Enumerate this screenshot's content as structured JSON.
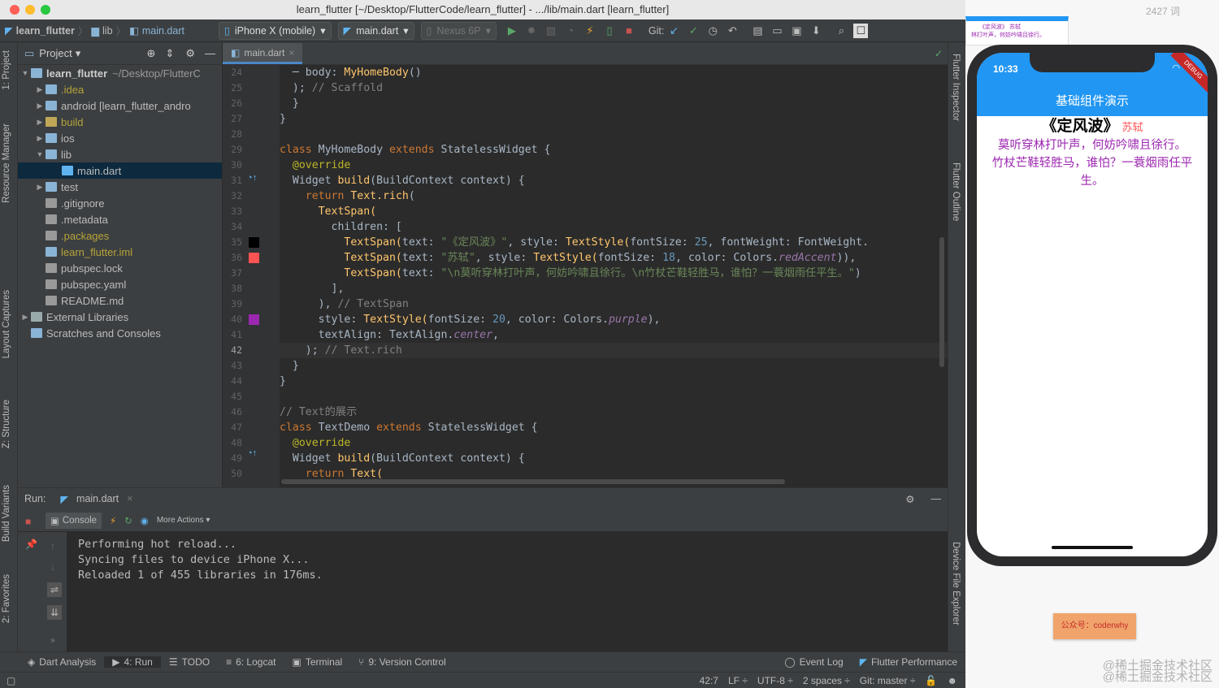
{
  "window": {
    "title": "learn_flutter [~/Desktop/FlutterCode/learn_flutter] - .../lib/main.dart [learn_flutter]"
  },
  "navbar": {
    "crumbs": [
      "learn_flutter",
      "lib",
      "main.dart"
    ],
    "device": "iPhone X (mobile)",
    "run_config": "main.dart",
    "emulator": "Nexus 6P",
    "git_label": "Git:"
  },
  "left_tabs": [
    "1: Project",
    "Resource Manager",
    "Layout Captures",
    "Z: Structure",
    "Build Variants",
    "2: Favorites"
  ],
  "right_tabs": [
    "Flutter Inspector",
    "Flutter Outline",
    "Device File Explorer"
  ],
  "project": {
    "header": "Project",
    "root_name": "learn_flutter",
    "root_path": "~/Desktop/FlutterC",
    "items": [
      {
        "name": ".idea",
        "color": "#b5a33a"
      },
      {
        "name": "android [learn_flutter_andro",
        "color": "#bbbbbb"
      },
      {
        "name": "build",
        "color": "#b5a33a"
      },
      {
        "name": "ios",
        "color": "#bbbbbb"
      },
      {
        "name": "lib",
        "color": "#bbbbbb"
      },
      {
        "name": "main.dart",
        "color": "#bbbbbb"
      },
      {
        "name": "test",
        "color": "#bbbbbb"
      },
      {
        "name": ".gitignore",
        "color": "#bbbbbb"
      },
      {
        "name": ".metadata",
        "color": "#bbbbbb"
      },
      {
        "name": ".packages",
        "color": "#b5a33a"
      },
      {
        "name": "learn_flutter.iml",
        "color": "#b5a33a"
      },
      {
        "name": "pubspec.lock",
        "color": "#bbbbbb"
      },
      {
        "name": "pubspec.yaml",
        "color": "#bbbbbb"
      },
      {
        "name": "README.md",
        "color": "#bbbbbb"
      },
      {
        "name": "External Libraries",
        "color": "#bbbbbb"
      },
      {
        "name": "Scratches and Consoles",
        "color": "#bbbbbb"
      }
    ]
  },
  "editor": {
    "tab": "main.dart",
    "line_numbers": [
      "24",
      "25",
      "26",
      "27",
      "28",
      "29",
      "30",
      "31",
      "32",
      "33",
      "34",
      "35",
      "36",
      "37",
      "38",
      "39",
      "40",
      "41",
      "42",
      "43",
      "44",
      "45",
      "46",
      "47",
      "48",
      "49",
      "50"
    ],
    "code": {
      "l24_a": "body: ",
      "l24_b": "MyHomeBody",
      "l24_c": "()",
      "l25_a": "); ",
      "l25_b": "// Scaffold",
      "l26": "}",
      "l27": "}",
      "l29_a": "class ",
      "l29_b": "MyHomeBody ",
      "l29_c": "extends ",
      "l29_d": "StatelessWidget {",
      "l30": "@override",
      "l31_a": "Widget ",
      "l31_b": "build",
      "l31_c": "(BuildContext context) {",
      "l32_a": "return ",
      "l32_b": "Text.rich",
      "l33": "TextSpan(",
      "l34": "children: [",
      "l35_a": "TextSpan(",
      "l35_b": "text: ",
      "l35_c": "\"《定风波》\"",
      "l35_d": ", style: ",
      "l35_e": "TextStyle(",
      "l35_f": "fontSize: ",
      "l35_g": "25",
      "l35_h": ", fontWeight: FontWeight.",
      "l36_a": "TextSpan(",
      "l36_b": "text: ",
      "l36_c": "\"苏轼\"",
      "l36_d": ", style: ",
      "l36_e": "TextStyle(",
      "l36_f": "fontSize: ",
      "l36_g": "18",
      "l36_h": ", color: Colors.",
      "l36_i": "redAccent",
      "l36_j": ")),",
      "l37_a": "TextSpan(",
      "l37_b": "text: ",
      "l37_c": "\"\\n莫听穿林打叶声，何妨吟啸且徐行。\\n竹杖芒鞋轻胜马，谁怕？一蓑烟雨任平生。\"",
      "l37_d": ")",
      "l38": "],",
      "l39_a": "), ",
      "l39_b": "// TextSpan",
      "l40_a": "style: ",
      "l40_b": "TextStyle(",
      "l40_c": "fontSize: ",
      "l40_d": "20",
      "l40_e": ", color: Colors.",
      "l40_f": "purple",
      "l40_g": "),",
      "l41_a": "textAlign: TextAlign.",
      "l41_b": "center",
      "l41_c": ",",
      "l42_a": "); ",
      "l42_b": "// Text.rich",
      "l43": "}",
      "l44": "}",
      "l46": "// Text的展示",
      "l47_a": "class ",
      "l47_b": "TextDemo ",
      "l47_c": "extends ",
      "l47_d": "StatelessWidget {",
      "l48": "@override",
      "l49_a": "Widget ",
      "l49_b": "build",
      "l49_c": "(BuildContext context) {",
      "l50_a": "return ",
      "l50_b": "Text("
    },
    "swatch_colors": {
      "black": "#000000",
      "red_accent": "#ff5252",
      "purple": "#9c27b0"
    }
  },
  "run": {
    "label": "Run:",
    "tab": "main.dart",
    "console_tab": "Console",
    "more_actions": "More Actions",
    "console_lines": [
      "Performing hot reload...",
      "Syncing files to device iPhone X...",
      "Reloaded 1 of 455 libraries in 176ms."
    ]
  },
  "bottom_tools": {
    "dart_analysis": "Dart Analysis",
    "run": "4: Run",
    "todo": "TODO",
    "logcat": "6: Logcat",
    "terminal": "Terminal",
    "version_control": "9: Version Control",
    "event_log": "Event Log",
    "flutter_performance": "Flutter Performance"
  },
  "status": {
    "position": "42:7",
    "line_sep": "LF",
    "encoding": "UTF-8",
    "indent": "2 spaces",
    "git": "Git: master"
  },
  "phone": {
    "time": "10:33",
    "debug": "DEBUG",
    "app_title": "基础组件演示",
    "poem_title": "《定风波》",
    "poem_author": "苏轼",
    "poem_line1": "莫听穿林打叶声，何妨吟啸且徐行。",
    "poem_line2": "竹杖芒鞋轻胜马，谁怕？一蓑烟雨任平生。",
    "author_color": "#ff5252",
    "text_color": "#9c27b0",
    "appbar_color": "#2196f3"
  },
  "mini_preview": {
    "line1": "《定风波》 苏轼",
    "line2": "林打叶声，何妨吟啸且徐行。"
  },
  "overlay": {
    "word_count": "2427 词",
    "badge": "公众号：coderwhy",
    "watermark1": "@稀土掘金技术社区",
    "watermark2": "@稀土掘金技术社区"
  }
}
